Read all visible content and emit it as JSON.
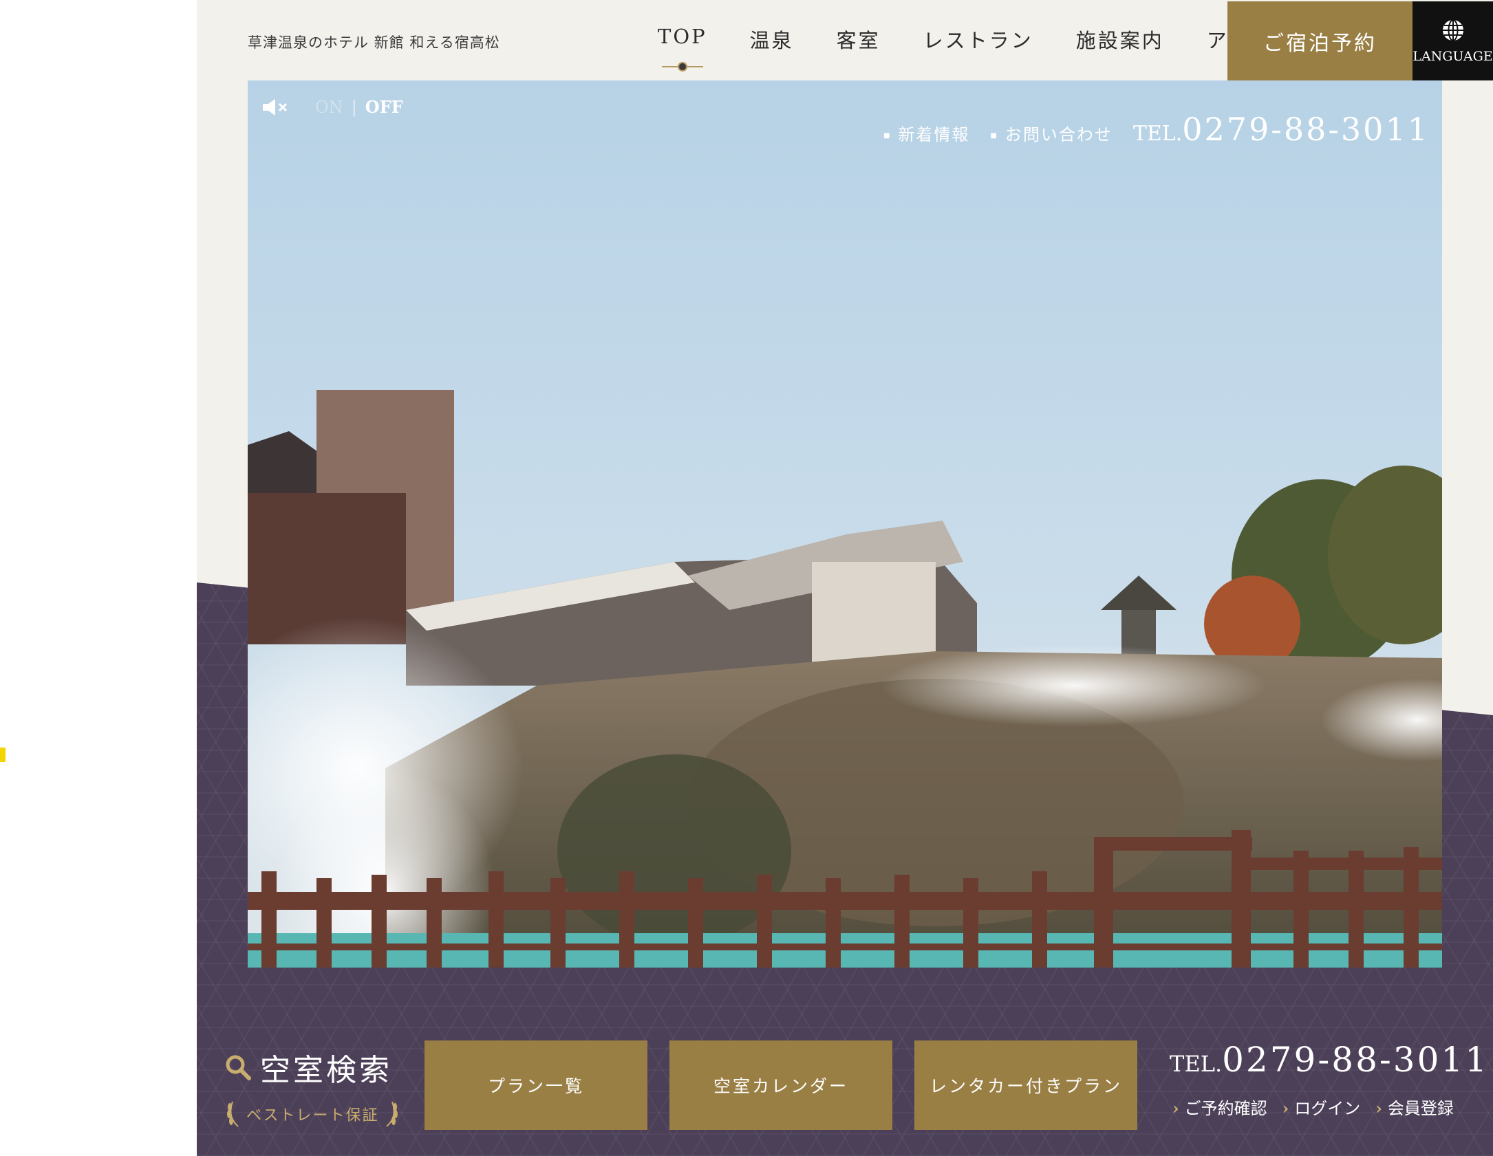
{
  "header": {
    "site_title": "草津温泉のホテル 新館 和える宿高松",
    "nav": [
      {
        "label": "TOP",
        "active": true
      },
      {
        "label": "温泉"
      },
      {
        "label": "客室"
      },
      {
        "label": "レストラン"
      },
      {
        "label": "施設案内"
      },
      {
        "label": "アクセス"
      }
    ],
    "reserve_label": "ご宿泊予約",
    "language_label": "LANGUAGE"
  },
  "hero": {
    "sound": {
      "on_label": "ON",
      "off_label": "OFF",
      "separator": "|"
    },
    "links": [
      "新着情報",
      "お問い合わせ"
    ],
    "tel_prefix": "TEL.",
    "tel_number": "0279-88-3011"
  },
  "search": {
    "title": "空室検索",
    "subtitle": "ベストレート保証",
    "buttons": [
      "プラン一覧",
      "空室カレンダー",
      "レンタカー付きプラン"
    ],
    "tel_prefix": "TEL.",
    "tel_number": "0279-88-3011",
    "links": [
      "ご予約確認",
      "ログイン",
      "会員登録"
    ]
  },
  "colors": {
    "gold": "#9a7f45",
    "purple": "#4c4058",
    "cream": "#f3f1ec",
    "black": "#111111"
  }
}
